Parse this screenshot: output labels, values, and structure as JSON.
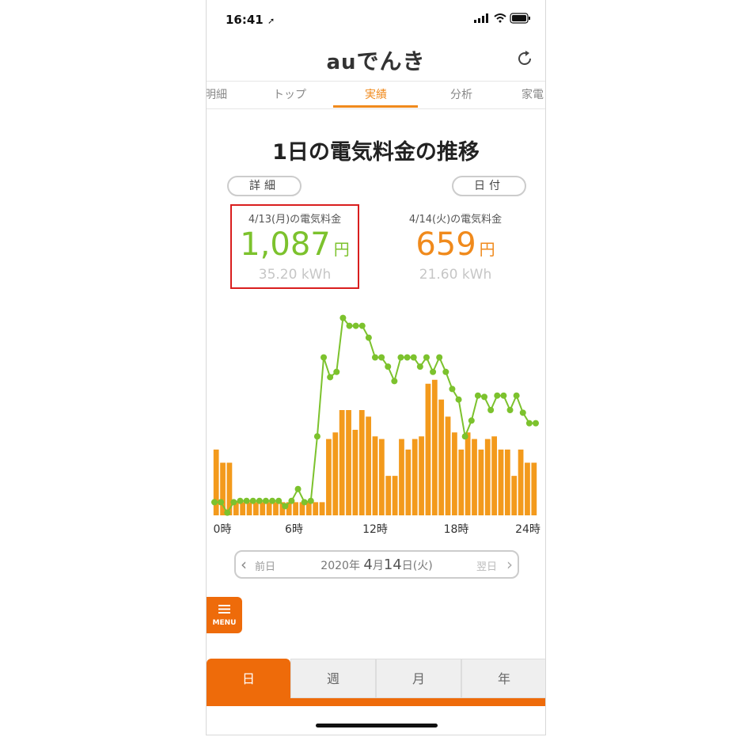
{
  "status_bar": {
    "time": "16:41",
    "location_arrow": "location-arrow-icon"
  },
  "header": {
    "brand_prefix": "au",
    "brand_main": "でんき",
    "refresh_icon": "refresh-icon"
  },
  "tabs": [
    {
      "label": "明細",
      "active": false
    },
    {
      "label": "トップ",
      "active": false
    },
    {
      "label": "実績",
      "active": true
    },
    {
      "label": "分析",
      "active": false
    },
    {
      "label": "家電",
      "active": false
    }
  ],
  "page_title": "1日の電気料金の推移",
  "buttons": {
    "detail": "詳細",
    "date": "日付"
  },
  "compare": {
    "prev_day": {
      "label": "4/13(月)の電気料金",
      "amount": "1,087",
      "unit": "円",
      "kwh": "35.20 kWh",
      "color": "#7cc22d"
    },
    "current_day": {
      "label": "4/14(火)の電気料金",
      "amount": "659",
      "unit": "円",
      "kwh": "21.60 kWh",
      "color": "#f08a1c"
    }
  },
  "chart_data": {
    "type": "bar",
    "x_tick_labels": [
      "0時",
      "6時",
      "12時",
      "18時",
      "24時"
    ],
    "series": [
      {
        "values": [
          50,
          40,
          40,
          10,
          10,
          10,
          10,
          10,
          10,
          10,
          10,
          10,
          10,
          10,
          10,
          10,
          10,
          58,
          63,
          80,
          80,
          65,
          80,
          75,
          60,
          58,
          30,
          30,
          58,
          50,
          58,
          60,
          100,
          103,
          88,
          75,
          63,
          50,
          63,
          58,
          50,
          58,
          60,
          50,
          50,
          30,
          50,
          40,
          40
        ],
        "color": "#f39a1c"
      },
      {
        "values": [
          10,
          10,
          2,
          10,
          11,
          11,
          11,
          11,
          11,
          11,
          11,
          7,
          11,
          20,
          10,
          11,
          60,
          120,
          105,
          109,
          150,
          144,
          144,
          144,
          135,
          120,
          120,
          113,
          102,
          120,
          120,
          120,
          113,
          120,
          109,
          120,
          109,
          96,
          88,
          60,
          72,
          91,
          90,
          80,
          91,
          91,
          80,
          91,
          78,
          70,
          70
        ],
        "color": "#7cc22d"
      }
    ],
    "ylim": [
      0,
      160
    ]
  },
  "date_nav": {
    "prev": "前日",
    "next": "翌日",
    "year": "2020",
    "year_unit": "年",
    "month": "4",
    "month_unit": "月",
    "day": "14",
    "day_unit": "日",
    "weekday": "(火)"
  },
  "menu": {
    "label": "MENU"
  },
  "bottom_tabs": [
    {
      "label": "日",
      "active": true
    },
    {
      "label": "週",
      "active": false
    },
    {
      "label": "月",
      "active": false
    },
    {
      "label": "年",
      "active": false
    }
  ]
}
